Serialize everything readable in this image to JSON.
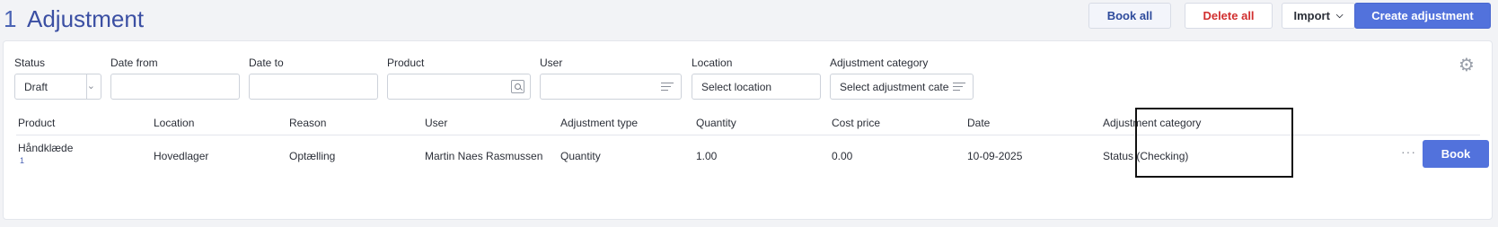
{
  "header": {
    "count": "1",
    "title": "Adjustment",
    "buttons": {
      "book_all": "Book all",
      "delete_all": "Delete all",
      "import": "Import",
      "create": "Create adjustment"
    }
  },
  "filters": {
    "status": {
      "label": "Status",
      "value": "Draft"
    },
    "date_from": {
      "label": "Date from",
      "value": ""
    },
    "date_to": {
      "label": "Date to",
      "value": ""
    },
    "product": {
      "label": "Product",
      "value": ""
    },
    "user": {
      "label": "User",
      "value": ""
    },
    "location": {
      "label": "Location",
      "value": "Select location"
    },
    "adjustment_category": {
      "label": "Adjustment category",
      "value": "Select adjustment category"
    }
  },
  "table": {
    "columns": [
      "Product",
      "Location",
      "Reason",
      "User",
      "Adjustment type",
      "Quantity",
      "Cost price",
      "Date",
      "Adjustment category"
    ],
    "rows": [
      {
        "product": "Håndklæde",
        "product_sub": "1",
        "location": "Hovedlager",
        "reason": "Optælling",
        "user": "Martin Naes Rasmussen",
        "adjustment_type": "Quantity",
        "quantity": "1.00",
        "cost_price": "0.00",
        "date": "10-09-2025",
        "adjustment_category": "Status (Checking)",
        "more": "···",
        "action": "Book"
      }
    ]
  },
  "icons": {
    "settings": "gear-icon",
    "status_caret": "chevron-down-icon",
    "import_caret": "chevron-down-icon",
    "product_search": "search-icon",
    "user_list": "list-icon",
    "category_list": "list-icon",
    "row_more": "more-icon"
  },
  "colors": {
    "accent": "#5272dc",
    "title": "#3b4fa3",
    "danger": "#d12f2f"
  }
}
